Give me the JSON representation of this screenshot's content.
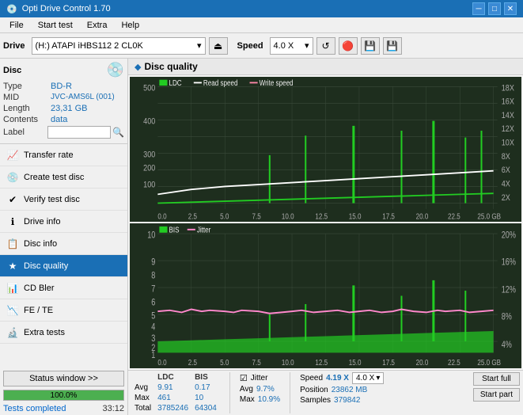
{
  "app": {
    "title": "Opti Drive Control 1.70",
    "title_icon": "●"
  },
  "title_controls": {
    "minimize": "─",
    "maximize": "□",
    "close": "✕"
  },
  "menu": {
    "items": [
      "File",
      "Start test",
      "Extra",
      "Help"
    ]
  },
  "toolbar": {
    "drive_label": "Drive",
    "drive_value": "(H:) ATAPI iHBS112  2 CL0K",
    "speed_label": "Speed",
    "speed_value": "4.0 X",
    "eject_icon": "⏏",
    "refresh_icon": "↺"
  },
  "disc": {
    "section_title": "Disc",
    "type_label": "Type",
    "type_value": "BD-R",
    "mid_label": "MID",
    "mid_value": "JVC-AMS6L (001)",
    "length_label": "Length",
    "length_value": "23,31 GB",
    "contents_label": "Contents",
    "contents_value": "data",
    "label_label": "Label",
    "label_value": ""
  },
  "nav_items": [
    {
      "id": "transfer-rate",
      "label": "Transfer rate",
      "icon": "📈"
    },
    {
      "id": "create-test-disc",
      "label": "Create test disc",
      "icon": "💿"
    },
    {
      "id": "verify-test-disc",
      "label": "Verify test disc",
      "icon": "✔"
    },
    {
      "id": "drive-info",
      "label": "Drive info",
      "icon": "ℹ"
    },
    {
      "id": "disc-info",
      "label": "Disc info",
      "icon": "📋"
    },
    {
      "id": "disc-quality",
      "label": "Disc quality",
      "icon": "★",
      "active": true
    },
    {
      "id": "cd-bler",
      "label": "CD Bler",
      "icon": "📊"
    },
    {
      "id": "fe-te",
      "label": "FE / TE",
      "icon": "📉"
    },
    {
      "id": "extra-tests",
      "label": "Extra tests",
      "icon": "🔬"
    }
  ],
  "status_window_btn": "Status window >>",
  "progress": {
    "value": 100,
    "label": "100.0%"
  },
  "status": {
    "text": "Tests completed",
    "time": "33:12"
  },
  "disc_quality": {
    "title": "Disc quality",
    "icon": "◆"
  },
  "chart_top": {
    "legend": [
      "LDC",
      "Read speed",
      "Write speed"
    ],
    "y_max": 500,
    "y_axis_right": [
      "18X",
      "16X",
      "14X",
      "12X",
      "10X",
      "8X",
      "6X",
      "4X",
      "2X"
    ],
    "x_axis": [
      "0.0",
      "2.5",
      "5.0",
      "7.5",
      "10.0",
      "12.5",
      "15.0",
      "17.5",
      "20.0",
      "22.5",
      "25.0 GB"
    ]
  },
  "chart_bottom": {
    "legend": [
      "BIS",
      "Jitter"
    ],
    "y_max": 10,
    "y_axis_right": [
      "20%",
      "16%",
      "12%",
      "8%",
      "4%"
    ],
    "x_axis": [
      "0.0",
      "2.5",
      "5.0",
      "7.5",
      "10.0",
      "12.5",
      "15.0",
      "17.5",
      "20.0",
      "22.5",
      "25.0 GB"
    ]
  },
  "stats": {
    "headers": [
      "",
      "LDC",
      "BIS"
    ],
    "avg_label": "Avg",
    "avg_ldc": "9.91",
    "avg_bis": "0.17",
    "max_label": "Max",
    "max_ldc": "461",
    "max_bis": "10",
    "total_label": "Total",
    "total_ldc": "3785246",
    "total_bis": "64304"
  },
  "jitter": {
    "checkbox_label": "Jitter",
    "avg_val": "9.7%",
    "max_val": "10.9%"
  },
  "speed_info": {
    "speed_label": "Speed",
    "speed_val": "4.19 X",
    "speed_dropdown": "4.0 X",
    "position_label": "Position",
    "position_val": "23862 MB",
    "samples_label": "Samples",
    "samples_val": "379842"
  },
  "action_buttons": {
    "start_full": "Start full",
    "start_part": "Start part"
  }
}
